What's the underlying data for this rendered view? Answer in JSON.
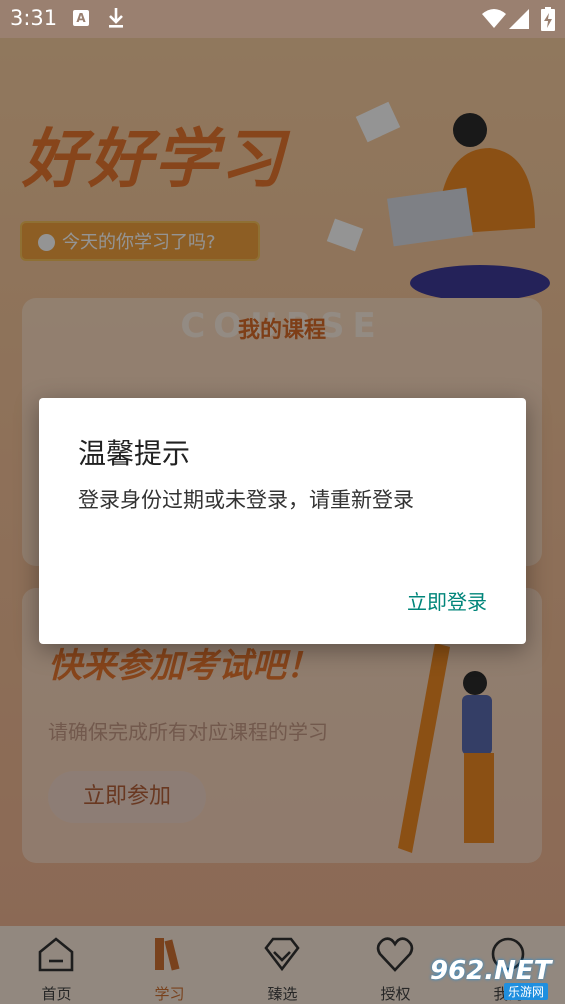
{
  "status_bar": {
    "time": "3:31",
    "notification_icons": [
      "text-a-icon",
      "download-icon"
    ],
    "system_icons": [
      "wifi-icon",
      "signal-icon",
      "battery-charging-icon"
    ]
  },
  "hero": {
    "title": "好好学习",
    "pill_text": "今天的你学习了吗?"
  },
  "course_card": {
    "watermark": "COURSE",
    "title": "我的课程"
  },
  "exam_card": {
    "title": "快来参加考试吧！",
    "subtitle": "请确保完成所有对应课程的学习",
    "button_label": "立即参加"
  },
  "nav": {
    "items": [
      {
        "label": "首页",
        "icon": "home-icon"
      },
      {
        "label": "学习",
        "icon": "books-icon",
        "active": true
      },
      {
        "label": "臻选",
        "icon": "diamond-icon"
      },
      {
        "label": "授权",
        "icon": "handshake-heart-icon"
      },
      {
        "label": "我的",
        "icon": "chat-bubble-icon"
      }
    ]
  },
  "dialog": {
    "title": "温馨提示",
    "message": "登录身份过期或未登录，请重新登录",
    "action_label": "立即登录"
  },
  "watermark": {
    "brand": "962.NET",
    "sub": "乐游网"
  },
  "colors": {
    "accent_orange": "#e8772f",
    "dialog_button": "#00857a",
    "nav_active": "#d07333"
  }
}
